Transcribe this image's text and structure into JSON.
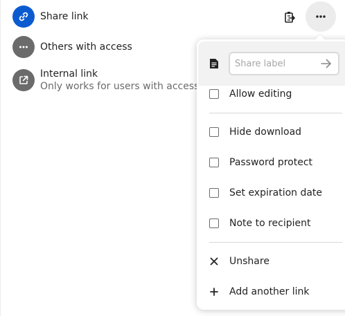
{
  "shares": {
    "share_link": {
      "title": "Share link",
      "icon": "link-icon",
      "color": "#0b5bd0"
    },
    "others": {
      "title": "Others with access",
      "icon": "dots-icon",
      "color": "#6b6b6b"
    },
    "internal": {
      "title": "Internal link",
      "subtitle": "Only works for users with access t",
      "icon": "external-link-icon",
      "color": "#6b6b6b"
    }
  },
  "actions": {
    "copy_icon": "clipboard-copy-icon",
    "menu_icon": "more-horizontal-icon"
  },
  "menu": {
    "label_input": {
      "placeholder": "Share label",
      "value": ""
    },
    "options": [
      {
        "label": "Allow editing",
        "checked": false
      },
      {
        "label": "Hide download",
        "checked": false
      },
      {
        "label": "Password protect",
        "checked": false
      },
      {
        "label": "Set expiration date",
        "checked": false
      },
      {
        "label": "Note to recipient",
        "checked": false
      }
    ],
    "unshare": {
      "label": "Unshare",
      "icon": "close-icon"
    },
    "add_link": {
      "label": "Add another link",
      "icon": "plus-icon"
    }
  },
  "colors": {
    "accent": "#0b5bd0",
    "avatar_grey": "#6b6b6b",
    "label_row_bg": "#f2f2f2",
    "toggle_bg": "#ececec"
  }
}
